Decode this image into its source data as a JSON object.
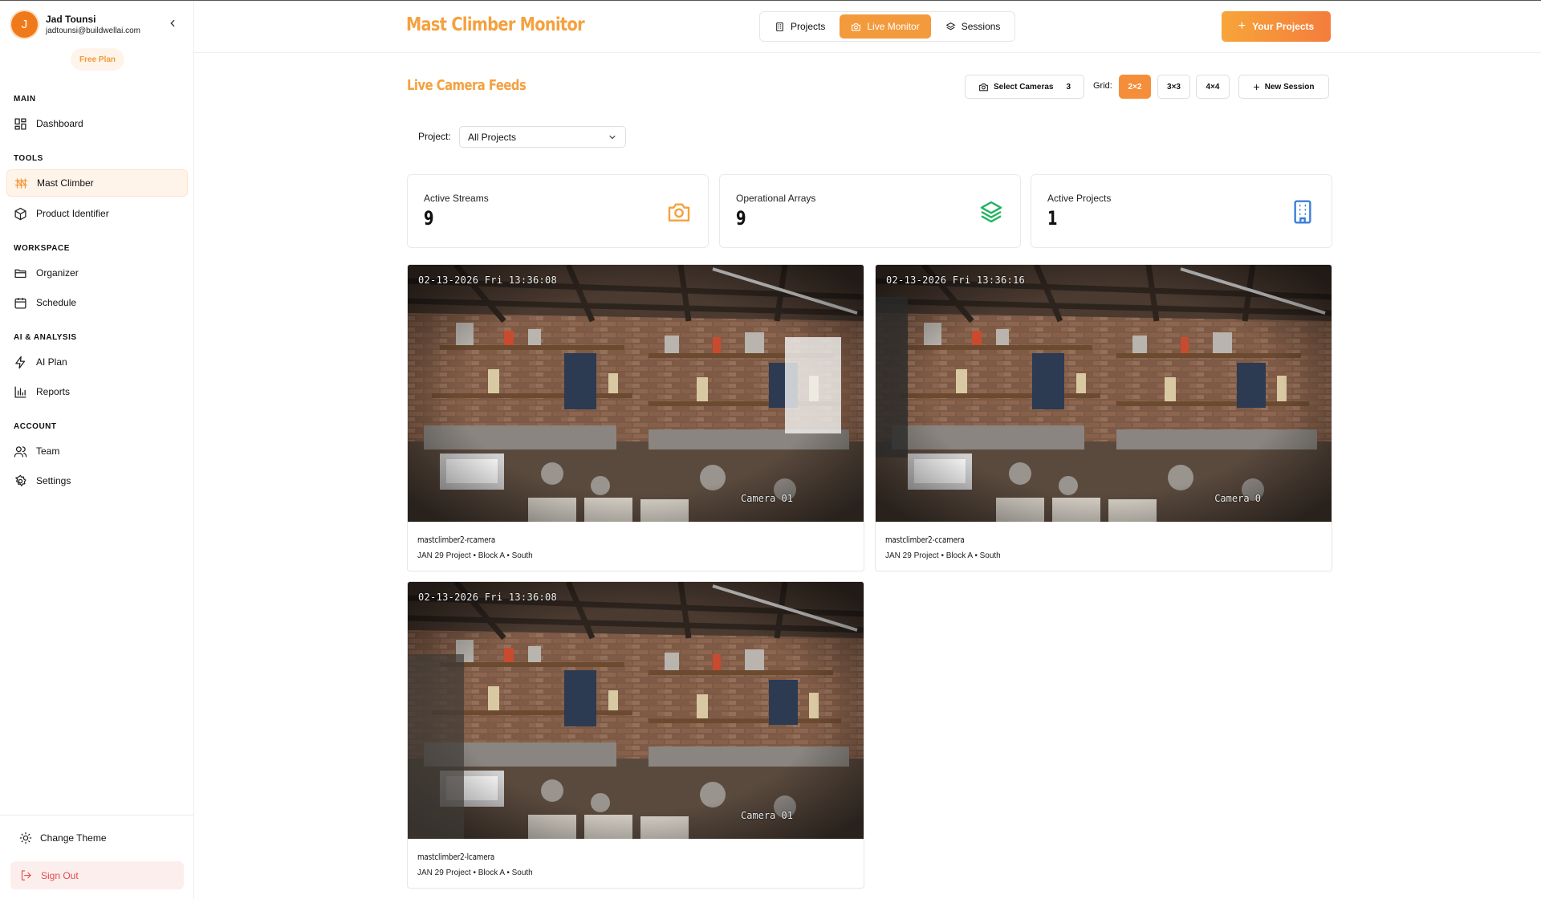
{
  "user": {
    "initial": "J",
    "name": "Jad Tounsi",
    "email": "jadtounsi@buildwellai.com",
    "plan": "Free Plan"
  },
  "sidebar": {
    "sections": {
      "main": "MAIN",
      "tools": "TOOLS",
      "workspace": "WORKSPACE",
      "ai": "AI & ANALYSIS",
      "account": "ACCOUNT"
    },
    "items": {
      "dashboard": "Dashboard",
      "mast_climber": "Mast Climber",
      "product_identifier": "Product Identifier",
      "organizer": "Organizer",
      "schedule": "Schedule",
      "ai_plan": "AI Plan",
      "reports": "Reports",
      "team": "Team",
      "settings": "Settings"
    },
    "active": "mast_climber",
    "change_theme": "Change Theme",
    "sign_out": "Sign Out"
  },
  "header": {
    "title": "Mast Climber Monitor",
    "tabs": {
      "projects": "Projects",
      "live_monitor": "Live Monitor",
      "sessions": "Sessions"
    },
    "active_tab": "live_monitor",
    "your_projects": "Your Projects"
  },
  "toolbar": {
    "title": "Live Camera Feeds",
    "select_cameras": "Select Cameras",
    "selected_count": "3",
    "grid_label": "Grid:",
    "grid_options": [
      "2×2",
      "3×3",
      "4×4"
    ],
    "active_grid": "2×2",
    "new_session": "New Session"
  },
  "filter": {
    "label": "Project:",
    "value": "All Projects"
  },
  "stats": [
    {
      "label": "Active Streams",
      "value": "9",
      "icon": "camera-icon",
      "color": "#f4a13f"
    },
    {
      "label": "Operational Arrays",
      "value": "9",
      "icon": "layers-icon",
      "color": "#22b35e"
    },
    {
      "label": "Active Projects",
      "value": "1",
      "icon": "building-icon",
      "color": "#3d7fd8"
    }
  ],
  "cameras": [
    {
      "timestamp": "02-13-2026 Fri 13:36:08",
      "overlay": "Camera 01",
      "name": "mastclimber2-rcamera",
      "meta": "JAN 29 Project • Block A • South"
    },
    {
      "timestamp": "02-13-2026 Fri 13:36:16",
      "overlay": "Camera 0",
      "name": "mastclimber2-ccamera",
      "meta": "JAN 29 Project • Block A • South"
    },
    {
      "timestamp": "02-13-2026 Fri 13:36:08",
      "overlay": "Camera 01",
      "name": "mastclimber2-lcamera",
      "meta": "JAN 29 Project • Block A • South"
    }
  ],
  "colors": {
    "accent": "#f4a13f",
    "accent_dark": "#f47d3c",
    "danger": "#e14b4b"
  }
}
